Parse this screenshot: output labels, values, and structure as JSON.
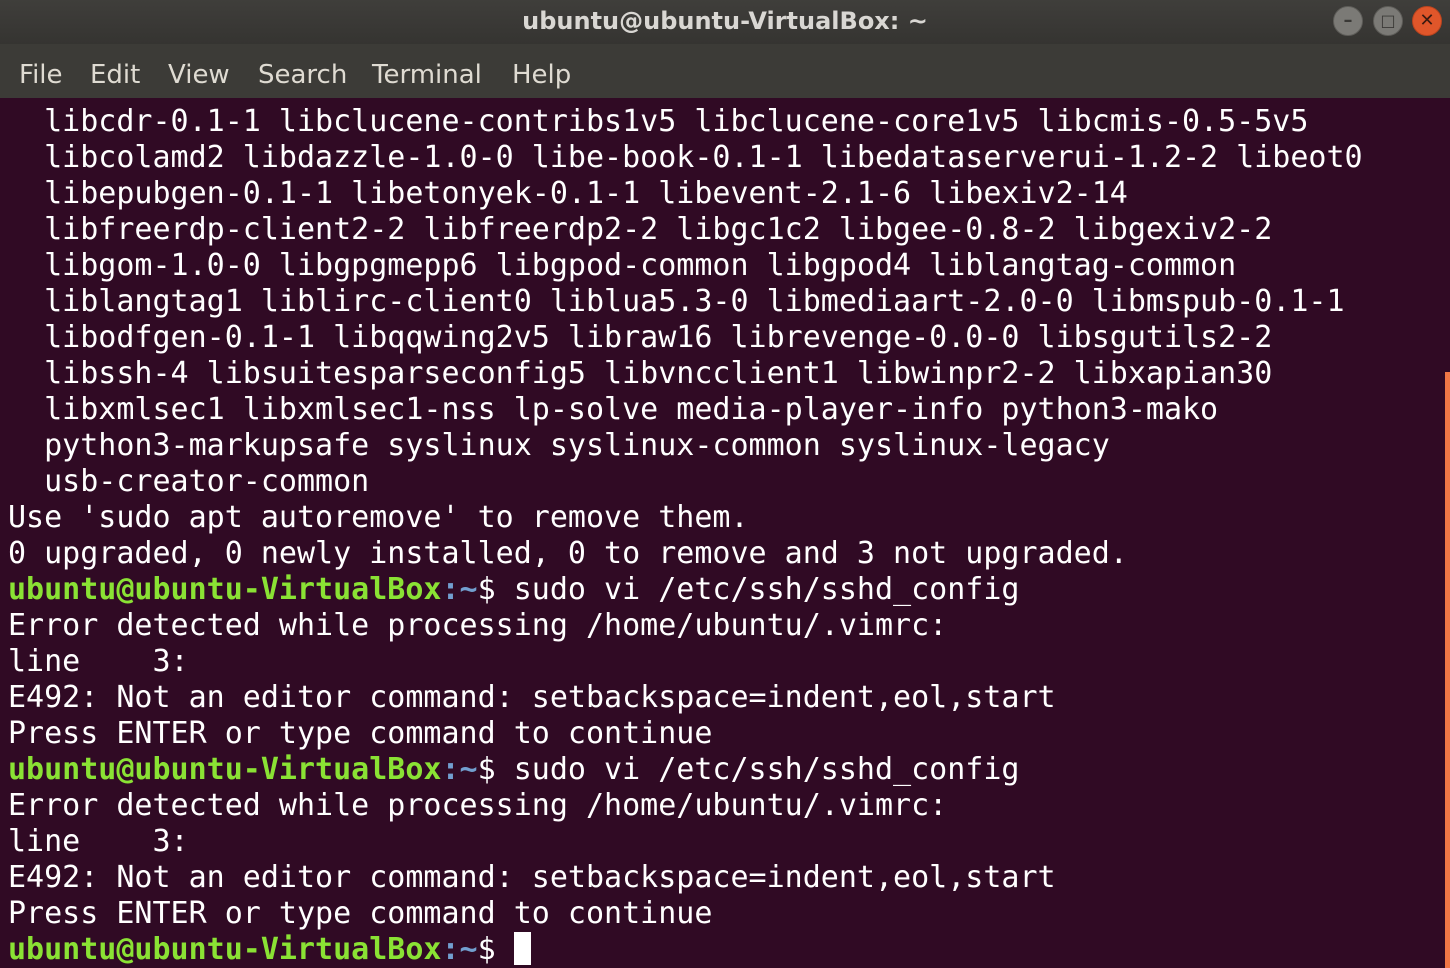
{
  "window": {
    "title": "ubuntu@ubuntu-VirtualBox: ~",
    "controls": {
      "minimize": "–",
      "maximize": "□",
      "close": "✕"
    }
  },
  "menu": [
    "File",
    "Edit",
    "View",
    "Search",
    "Terminal",
    "Help"
  ],
  "terminal": {
    "package_lines": [
      "  libcdr-0.1-1 libclucene-contribs1v5 libclucene-core1v5 libcmis-0.5-5v5",
      "  libcolamd2 libdazzle-1.0-0 libe-book-0.1-1 libedataserverui-1.2-2 libeot0",
      "  libepubgen-0.1-1 libetonyek-0.1-1 libevent-2.1-6 libexiv2-14",
      "  libfreerdp-client2-2 libfreerdp2-2 libgc1c2 libgee-0.8-2 libgexiv2-2",
      "  libgom-1.0-0 libgpgmepp6 libgpod-common libgpod4 liblangtag-common",
      "  liblangtag1 liblirc-client0 liblua5.3-0 libmediaart-2.0-0 libmspub-0.1-1",
      "  libodfgen-0.1-1 libqqwing2v5 libraw16 librevenge-0.0-0 libsgutils2-2",
      "  libssh-4 libsuitesparseconfig5 libvncclient1 libwinpr2-2 libxapian30",
      "  libxmlsec1 libxmlsec1-nss lp-solve media-player-info python3-mako",
      "  python3-markupsafe syslinux syslinux-common syslinux-legacy",
      "  usb-creator-common"
    ],
    "autoremove_hint": "Use 'sudo apt autoremove' to remove them.",
    "summary": "0 upgraded, 0 newly installed, 0 to remove and 3 not upgraded.",
    "prompt_user": "ubuntu@ubuntu-VirtualBox",
    "prompt_path": ":~",
    "prompt_symbol": "$ ",
    "command": "sudo vi /etc/ssh/sshd_config",
    "error_header": "Error detected while processing /home/ubuntu/.vimrc:",
    "error_line": "line    3:",
    "error_message": "E492: Not an editor command: setbackspace=indent,eol,start",
    "press_enter": "Press ENTER or type command to continue"
  },
  "colors": {
    "background": "#300a24",
    "prompt_user": "#8ae234",
    "prompt_path": "#729fcf",
    "text": "#ffffff",
    "scrollbar": "#f07746"
  }
}
